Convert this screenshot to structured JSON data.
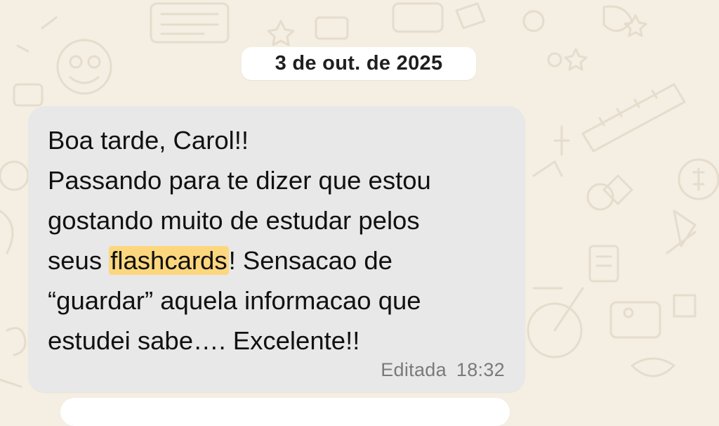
{
  "chat": {
    "date_separator": "3 de out. de 2025",
    "message": {
      "line1": "Boa tarde, Carol!!",
      "line2": "Passando para te dizer que estou",
      "line3": "gostando muito de estudar pelos",
      "line4_before": "seus ",
      "line4_highlight": "flashcards",
      "line4_after": "! Sensacao de",
      "line5": "“guardar” aquela informacao que",
      "line6": "estudei sabe…. Excelente!!",
      "edited_label": "Editada",
      "time": "18:32"
    }
  },
  "colors": {
    "wallpaper": "#f4eee3",
    "bubble": "#e8e8e8",
    "highlight": "#fdd77e",
    "date_pill": "#ffffff"
  }
}
